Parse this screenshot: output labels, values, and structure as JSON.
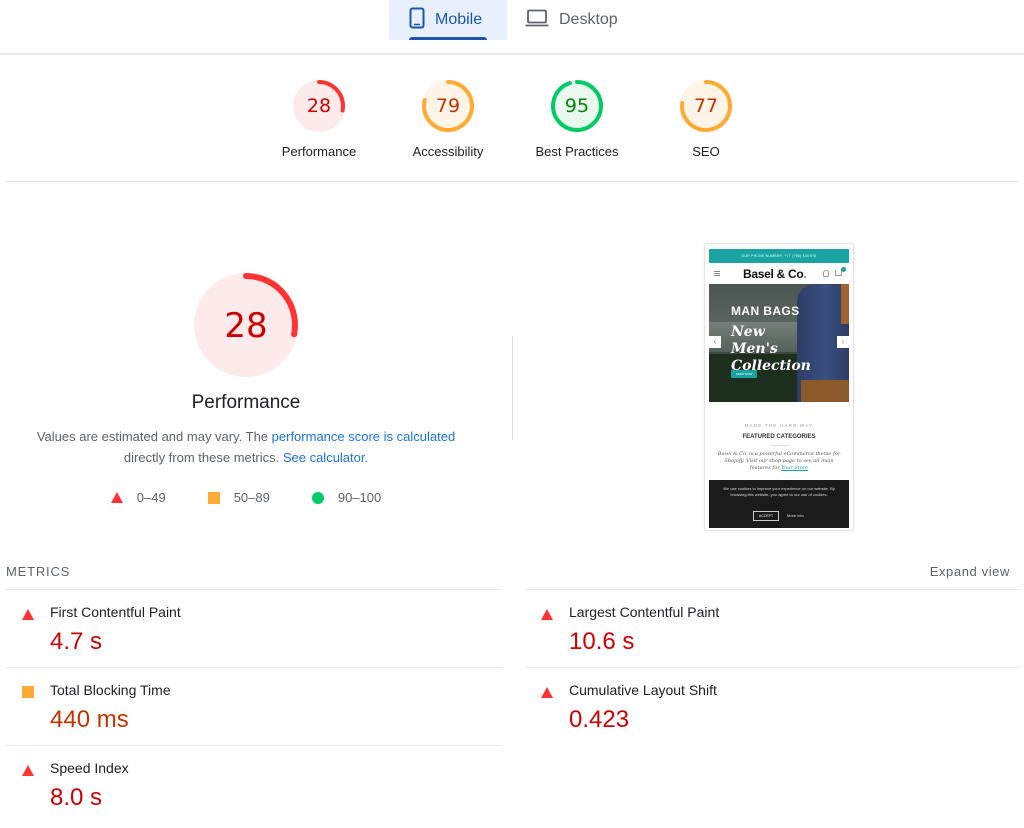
{
  "tabs": [
    {
      "label": "Mobile",
      "icon": "smartphone-icon",
      "active": true
    },
    {
      "label": "Desktop",
      "icon": "laptop-icon",
      "active": false
    }
  ],
  "categories": [
    {
      "label": "Performance",
      "score": 28,
      "rating": "fail"
    },
    {
      "label": "Accessibility",
      "score": 79,
      "rating": "average"
    },
    {
      "label": "Best Practices",
      "score": 95,
      "rating": "pass"
    },
    {
      "label": "SEO",
      "score": 77,
      "rating": "average"
    }
  ],
  "colors": {
    "fail": "#ff3333",
    "fail_text": "#cc0000",
    "fail_bg": "#fdeaea",
    "average": "#ffaa33",
    "average_text": "#c33300",
    "average_bg": "#fff4e8",
    "pass": "#00cc66",
    "pass_text": "#008800",
    "pass_bg": "#eaf8ef",
    "accent": "#1a56b0",
    "link": "#1a73e8"
  },
  "performance": {
    "score": 28,
    "label": "Performance",
    "desc_prefix": "Values are estimated and may vary. The ",
    "desc_link1": "performance score is calculated",
    "desc_mid": " directly from these metrics. ",
    "desc_link2": "See calculator."
  },
  "legend": [
    {
      "shape": "triangle",
      "range": "0–49"
    },
    {
      "shape": "square",
      "range": "50–89"
    },
    {
      "shape": "circle",
      "range": "90–100"
    }
  ],
  "screenshot": {
    "topbar": "OUR PHONE NUMBER:   +77 (756) 334 876",
    "brand": "Basel & Co",
    "brand_dot": ".",
    "hero_title": "MAN BAGS",
    "hero_script": "New Men's Collection",
    "hero_button": "SHOP NOW",
    "arrow_left": "‹",
    "arrow_right": "›",
    "tagline": "MADE THE HARD WAY",
    "featured": "FEATURED CATEGORIES",
    "about": "Basel & Co. is a powerful eCommerce theme for Shopify. Visit our shop page to see all main features for ",
    "about_link": "Your Store",
    "cookie_text": "We use cookies to improve your experience on our website. By browsing this website, you agree to our use of cookies.",
    "accept": "ACCEPT",
    "more_info": "More info"
  },
  "metrics": {
    "title": "METRICS",
    "expand": "Expand view",
    "left": [
      {
        "name": "First Contentful Paint",
        "value": "4.7 s",
        "rating": "fail"
      },
      {
        "name": "Total Blocking Time",
        "value": "440 ms",
        "rating": "average"
      },
      {
        "name": "Speed Index",
        "value": "8.0 s",
        "rating": "fail"
      }
    ],
    "right": [
      {
        "name": "Largest Contentful Paint",
        "value": "10.6 s",
        "rating": "fail"
      },
      {
        "name": "Cumulative Layout Shift",
        "value": "0.423",
        "rating": "fail"
      }
    ]
  }
}
